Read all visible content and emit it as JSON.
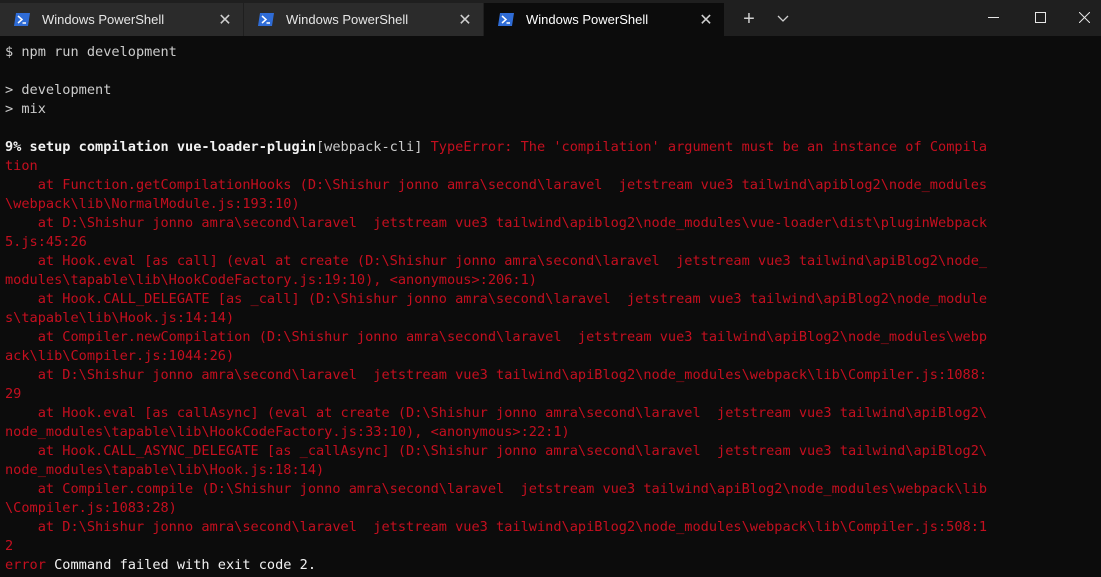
{
  "tabs": [
    {
      "label": "Windows PowerShell"
    },
    {
      "label": "Windows PowerShell"
    },
    {
      "label": "Windows PowerShell"
    }
  ],
  "icons": {
    "tab": "powershell-icon",
    "close": "close-icon",
    "new_tab": "plus-icon",
    "dropdown": "chevron-down-icon",
    "minimize": "minimize-icon",
    "maximize": "maximize-icon",
    "window_close": "close-icon"
  },
  "colors": {
    "error_red": "#c50f1f",
    "text": "#cccccc",
    "background": "#0c0c0c"
  },
  "terminal": {
    "prompt_line": "$ npm run development",
    "script_lines": [
      "> development",
      "> mix"
    ],
    "progress_bold": "9% setup compilation vue-loader-plugin",
    "progress_bracket": "[webpack-cli]",
    "error_lines": [
      " TypeError: The 'compilation' argument must be an instance of Compila",
      "tion",
      "    at Function.getCompilationHooks (D:\\Shishur jonno amra\\second\\laravel  jetstream vue3 tailwind\\apiblog2\\node_modules",
      "\\webpack\\lib\\NormalModule.js:193:10)",
      "    at D:\\Shishur jonno amra\\second\\laravel  jetstream vue3 tailwind\\apiblog2\\node_modules\\vue-loader\\dist\\pluginWebpack",
      "5.js:45:26",
      "    at Hook.eval [as call] (eval at create (D:\\Shishur jonno amra\\second\\laravel  jetstream vue3 tailwind\\apiBlog2\\node_",
      "modules\\tapable\\lib\\HookCodeFactory.js:19:10), <anonymous>:206:1)",
      "    at Hook.CALL_DELEGATE [as _call] (D:\\Shishur jonno amra\\second\\laravel  jetstream vue3 tailwind\\apiBlog2\\node_module",
      "s\\tapable\\lib\\Hook.js:14:14)",
      "    at Compiler.newCompilation (D:\\Shishur jonno amra\\second\\laravel  jetstream vue3 tailwind\\apiBlog2\\node_modules\\webp",
      "ack\\lib\\Compiler.js:1044:26)",
      "    at D:\\Shishur jonno amra\\second\\laravel  jetstream vue3 tailwind\\apiBlog2\\node_modules\\webpack\\lib\\Compiler.js:1088:",
      "29",
      "    at Hook.eval [as callAsync] (eval at create (D:\\Shishur jonno amra\\second\\laravel  jetstream vue3 tailwind\\apiBlog2\\",
      "node_modules\\tapable\\lib\\HookCodeFactory.js:33:10), <anonymous>:22:1)",
      "    at Hook.CALL_ASYNC_DELEGATE [as _callAsync] (D:\\Shishur jonno amra\\second\\laravel  jetstream vue3 tailwind\\apiBlog2\\",
      "node_modules\\tapable\\lib\\Hook.js:18:14)",
      "    at Compiler.compile (D:\\Shishur jonno amra\\second\\laravel  jetstream vue3 tailwind\\apiBlog2\\node_modules\\webpack\\lib",
      "\\Compiler.js:1083:28)",
      "    at D:\\Shishur jonno amra\\second\\laravel  jetstream vue3 tailwind\\apiBlog2\\node_modules\\webpack\\lib\\Compiler.js:508:1",
      "2"
    ],
    "final_error_word": "error",
    "final_error_message": " Command failed with exit code 2."
  }
}
